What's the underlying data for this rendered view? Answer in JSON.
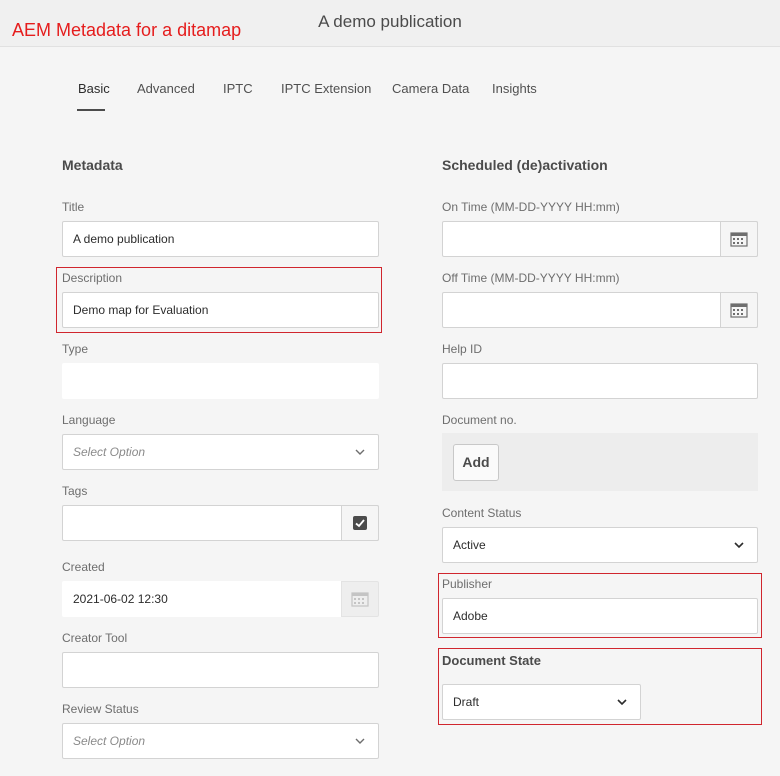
{
  "annotation": {
    "text": "AEM Metadata for a ditamap",
    "color": "#e51d1d"
  },
  "header": {
    "title": "A demo publication"
  },
  "tabs": [
    {
      "label": "Basic",
      "active": true
    },
    {
      "label": "Advanced"
    },
    {
      "label": "IPTC"
    },
    {
      "label": "IPTC Extension"
    },
    {
      "label": "Camera Data"
    },
    {
      "label": "Insights"
    }
  ],
  "metadata": {
    "heading": "Metadata",
    "title": {
      "label": "Title",
      "value": "A demo publication"
    },
    "description": {
      "label": "Description",
      "value": "Demo map for Evaluation"
    },
    "type": {
      "label": "Type",
      "value": ""
    },
    "language": {
      "label": "Language",
      "placeholder": "Select Option"
    },
    "tags": {
      "label": "Tags",
      "value": ""
    },
    "created": {
      "label": "Created",
      "value": "2021-06-02 12:30"
    },
    "creator_tool": {
      "label": "Creator Tool",
      "value": ""
    },
    "review_status": {
      "label": "Review Status",
      "placeholder": "Select Option"
    }
  },
  "scheduled": {
    "heading": "Scheduled (de)activation",
    "on_time": {
      "label": "On Time (MM-DD-YYYY HH:mm)",
      "value": ""
    },
    "off_time": {
      "label": "Off Time (MM-DD-YYYY HH:mm)",
      "value": ""
    },
    "help_id": {
      "label": "Help ID",
      "value": ""
    },
    "document_no": {
      "label": "Document no.",
      "add_label": "Add"
    },
    "content_status": {
      "label": "Content Status",
      "value": "Active"
    },
    "publisher": {
      "label": "Publisher",
      "value": "Adobe"
    },
    "document_state": {
      "label": "Document State",
      "value": "Draft"
    }
  },
  "colors": {
    "highlight_box": "#d0262e",
    "background": "#f5f5f5"
  }
}
